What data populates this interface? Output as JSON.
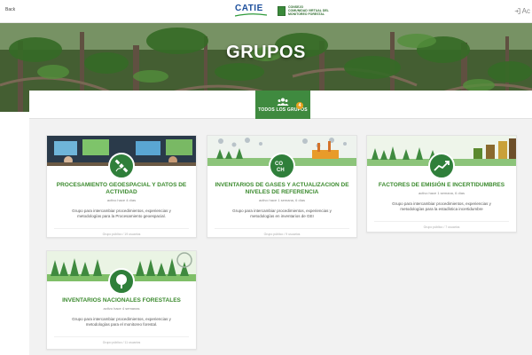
{
  "header": {
    "back_label": "Back",
    "catie_logo": "CATIE",
    "mf_logo_lines": [
      "CONSEJO",
      "COMUNIDAD VIRTUAL DEL",
      "MONITOREO FORESTAL"
    ],
    "login_label": "Ac"
  },
  "hero": {
    "title": "GRUPOS"
  },
  "tab": {
    "label": "TODOS LOS GRUPOS",
    "badge": "4"
  },
  "colors": {
    "accent": "#3f8a3f",
    "title_green": "#3b8a2e",
    "badge": "#e9a21f"
  },
  "cards": [
    {
      "icon": "satellite-icon",
      "title": "PROCESAMIENTO GEOESPACIAL Y DATOS DE ACTIVIDAD",
      "activity": "activo hace 4 días",
      "description": "Grupo para intercambiar procedimientos, experiencias y metodologías para la Procesamiento geoespacial.",
      "footer": "Grupo público / 19 usuarios"
    },
    {
      "icon": "co2-ch4-icon",
      "title": "INVENTARIOS DE GASES Y ACTUALIZACION DE NIVELES DE REFERENCIA",
      "activity": "activo hace 1 semana, 6 días",
      "description": "Grupo para intercambiar procedimientos, experiencias y metodologías en inventarios de GEI",
      "footer": "Grupo público / 9 usuarios"
    },
    {
      "icon": "trend-chart-icon",
      "title": "FACTORES DE EMISIÓN E INCERTIDUMBRES",
      "activity": "activo hace 1 semana, 6 días",
      "description": "Grupo para intercambiar procedimientos, experiencias y metodologías para la estadística incertidumbre",
      "footer": "Grupo público / 7 usuarios"
    },
    {
      "icon": "tree-icon",
      "title": "INVENTARIOS NACIONALES FORESTALES",
      "activity": "activo hace 4 semanas",
      "description": "Grupo para intercambiar procedimientos, experiencias y metodologías para el monitoreo forestal.",
      "footer": "Grupo público / 11 usuarios"
    }
  ]
}
